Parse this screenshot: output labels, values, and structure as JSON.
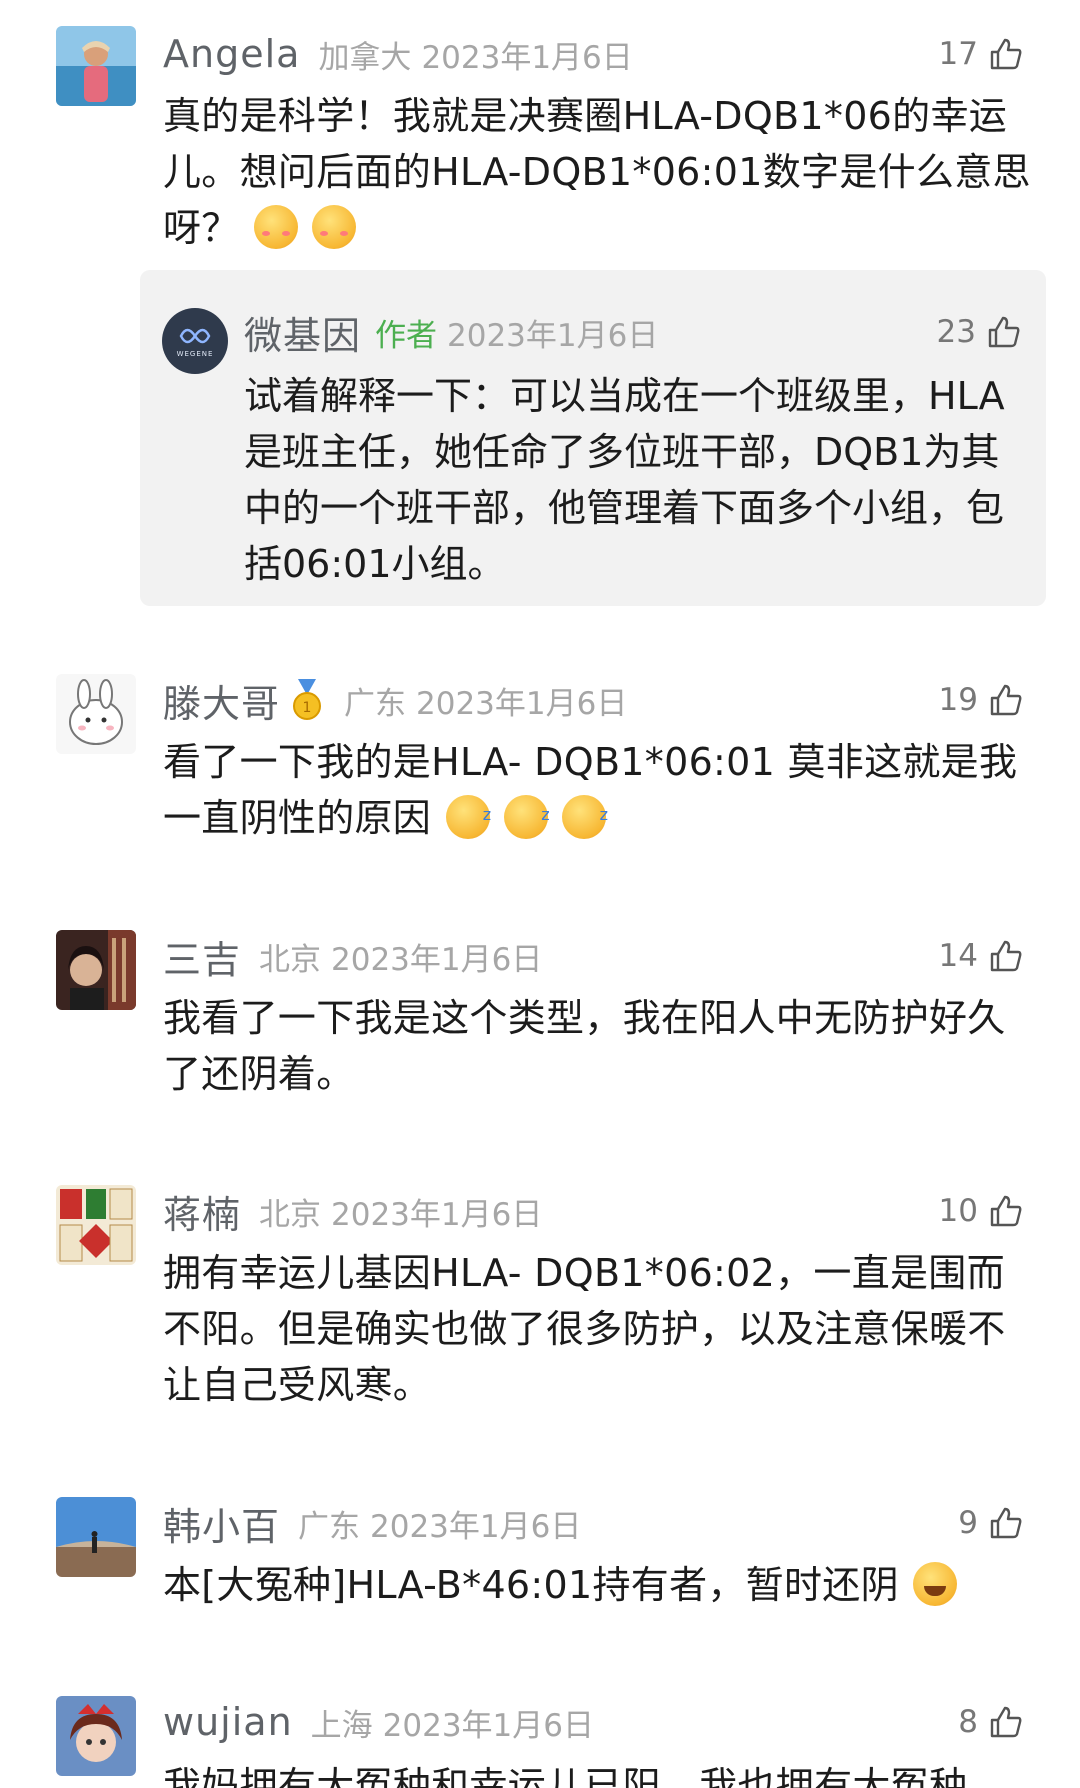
{
  "comments": [
    {
      "name": "Angela",
      "location": "加拿大",
      "date": "2023年1月6日",
      "likes": "17",
      "text": "真的是科学！我就是决赛圈HLA-DQB1*06的幸运儿。想问后面的HLA-DQB1*06:01数字是什么意思呀？",
      "avatar_icon": "beach-portrait",
      "reply": {
        "name": "微基因",
        "tag": "作者",
        "date": "2023年1月6日",
        "likes": "23",
        "text": "试着解释一下：可以当成在一个班级里，HLA是班主任，她任命了多位班干部，DQB1为其中的一个班干部，他管理着下面多个小组，包括06:01小组。",
        "avatar_text": "WEGENE"
      }
    },
    {
      "name": "滕大哥",
      "location": "广东",
      "date": "2023年1月6日",
      "likes": "19",
      "text": "看了一下我的是HLA- DQB1*06:01 莫非这就是我一直阴性的原因",
      "avatar_icon": "cartoon-rabbit"
    },
    {
      "name": "三吉",
      "location": "北京",
      "date": "2023年1月6日",
      "likes": "14",
      "text": "我看了一下我是这个类型，我在阳人中无防护好久了还阴着。",
      "avatar_icon": "photo-portrait"
    },
    {
      "name": "蒋楠",
      "location": "北京",
      "date": "2023年1月6日",
      "likes": "10",
      "text": "拥有幸运儿基因HLA- DQB1*06:02，一直是围而不阳。但是确实也做了很多防护，以及注意保暖不让自己受风寒。",
      "avatar_icon": "lucky-poster"
    },
    {
      "name": "韩小百",
      "location": "广东",
      "date": "2023年1月6日",
      "likes": "9",
      "text": "本[大冤种]HLA-B*46:01持有者，暂时还阴",
      "avatar_icon": "landscape-photo"
    },
    {
      "name": "wujian",
      "location": "上海",
      "date": "2023年1月6日",
      "likes": "8",
      "text": "我妈拥有大冤种和幸运儿已阳，我也拥有大冤种",
      "avatar_icon": "anime-girl"
    }
  ],
  "colors": {
    "name": "#5f6368",
    "meta": "#a6a6a6",
    "author_tag": "#4caf50",
    "reply_bg": "#f2f2f2"
  }
}
